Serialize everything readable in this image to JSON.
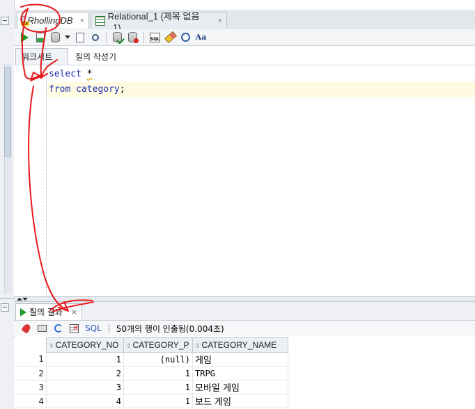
{
  "tabs": [
    {
      "label": "RhollingDB",
      "close": "×",
      "icon": "sql-db-icon",
      "active": true
    },
    {
      "label": "Relational_1 (제목 없음_1)",
      "close": "×",
      "icon": "relational-model-icon",
      "active": false
    }
  ],
  "subtabs": [
    {
      "label": "워크시트",
      "active": true
    },
    {
      "label": "질의 작성기",
      "active": false
    }
  ],
  "editor": {
    "lines": [
      {
        "parts": [
          "select",
          " ",
          "*"
        ]
      },
      {
        "parts": [
          "from",
          " ",
          "category",
          ";"
        ]
      }
    ]
  },
  "results": {
    "tab_label": "질의 결과",
    "tab_close": "×",
    "toolbar": {
      "sql_label": "SQL",
      "separator": "|",
      "status": "50개의 행이 인출됨(0.004초)"
    },
    "columns": [
      "CATEGORY_NO",
      "CATEGORY_P",
      "CATEGORY_NAME"
    ],
    "rows": [
      {
        "num": "1",
        "no": "1",
        "parent": "(null)",
        "name": "게임"
      },
      {
        "num": "2",
        "no": "2",
        "parent": "1",
        "name": "TRPG"
      },
      {
        "num": "3",
        "no": "3",
        "parent": "1",
        "name": "모바일 게임"
      },
      {
        "num": "4",
        "no": "4",
        "parent": "1",
        "name": "보드 게임"
      }
    ]
  },
  "colors": {
    "keyword": "#1d2fb0",
    "annotation": "#e8181a",
    "current_line": "#fffbe2",
    "run_green": "#1f9a2a"
  }
}
